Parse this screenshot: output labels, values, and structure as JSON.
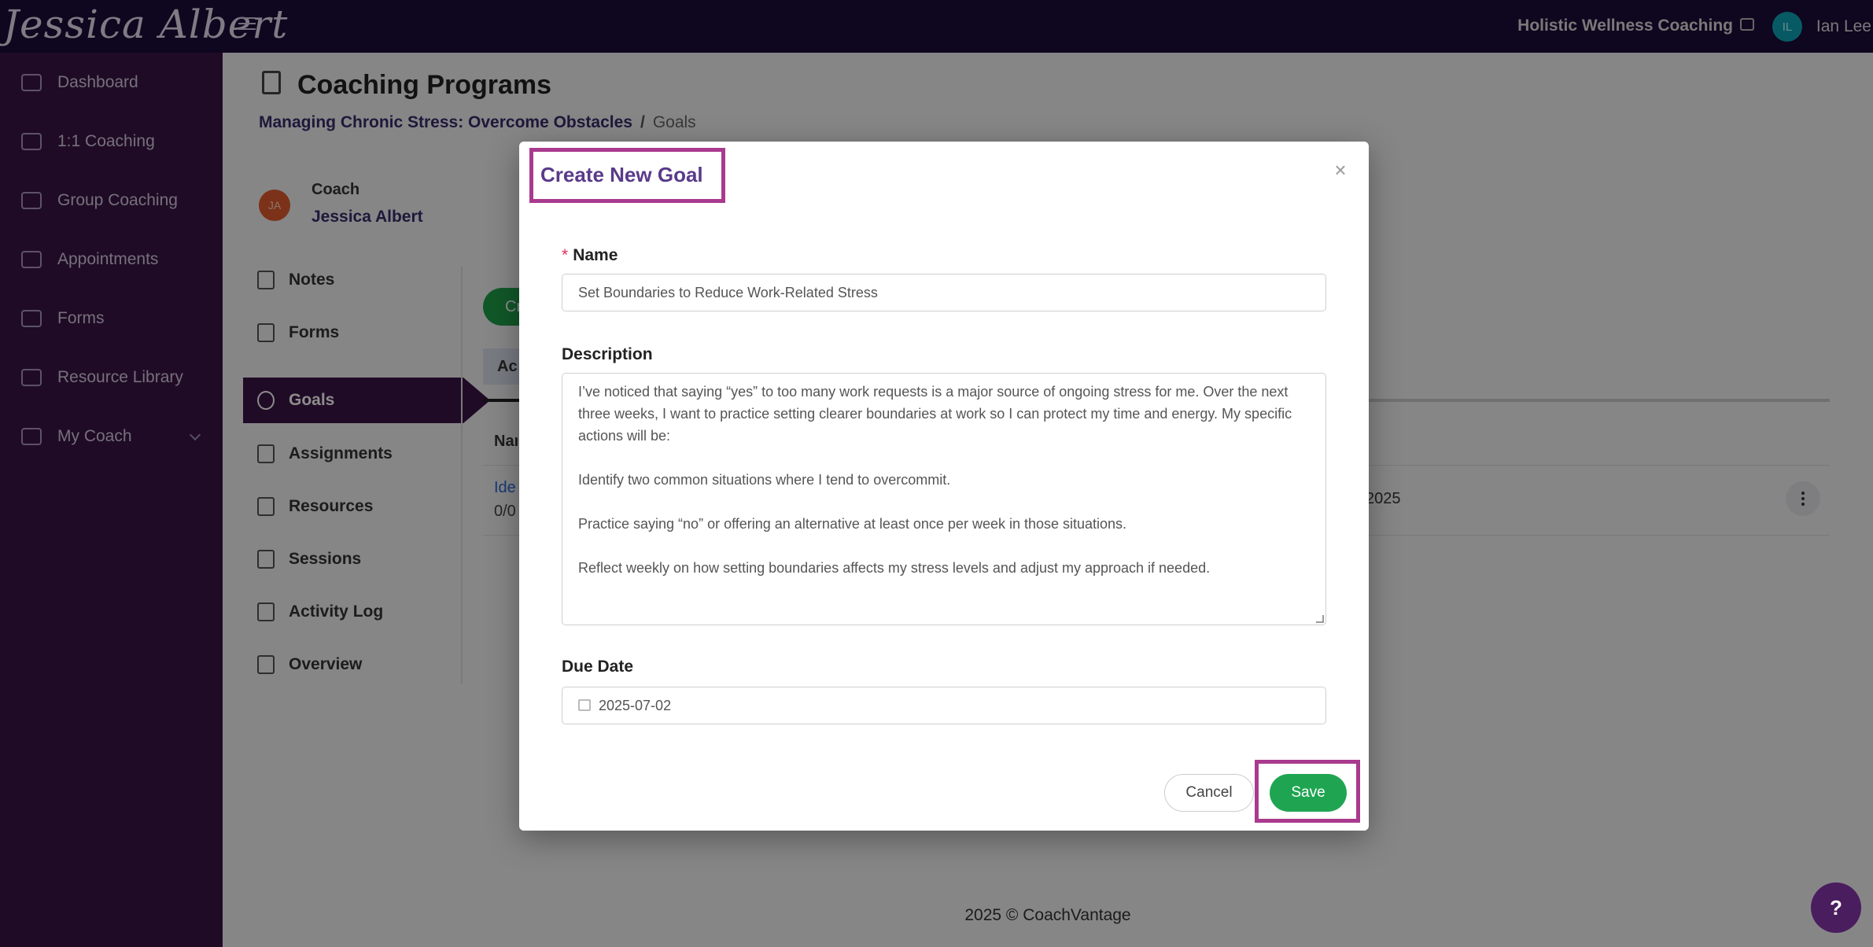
{
  "topbar": {
    "brand": "Jessica Albert",
    "org_name": "Holistic Wellness Coaching",
    "user_initials": "IL",
    "user_name": "Ian Lee"
  },
  "sidebar": {
    "items": [
      {
        "label": "Dashboard"
      },
      {
        "label": "1:1 Coaching"
      },
      {
        "label": "Group Coaching"
      },
      {
        "label": "Appointments"
      },
      {
        "label": "Forms"
      },
      {
        "label": "Resource Library"
      },
      {
        "label": "My Coach"
      }
    ]
  },
  "page": {
    "title": "Coaching Programs",
    "breadcrumb_parent": "Managing Chronic Stress: Overcome Obstacles",
    "breadcrumb_sep": "/",
    "breadcrumb_current": "Goals"
  },
  "coach": {
    "initials": "JA",
    "label": "Coach",
    "name": "Jessica Albert"
  },
  "subnav": {
    "items": [
      {
        "label": "Notes"
      },
      {
        "label": "Forms"
      },
      {
        "label": "Goals"
      },
      {
        "label": "Assignments"
      },
      {
        "label": "Resources"
      },
      {
        "label": "Sessions"
      },
      {
        "label": "Activity Log"
      },
      {
        "label": "Overview"
      }
    ]
  },
  "background": {
    "create_button_partial": "Cr",
    "tab_partial": "Ac",
    "table_header_partial": "Nar",
    "row_link_partial": "Ide",
    "row_progress_partial": "0/0",
    "row_date_partial": "2025"
  },
  "footer": {
    "text": "2025 © CoachVantage"
  },
  "modal": {
    "title": "Create New Goal",
    "close_glyph": "×",
    "name_label": "Name",
    "required_mark": "*",
    "name_value": "Set Boundaries to Reduce Work-Related Stress",
    "description_label": "Description",
    "description_paragraphs": [
      "I’ve noticed that saying “yes” to too many work requests is a major source of ongoing stress for me. Over the next three weeks, I want to practice setting clearer boundaries at work so I can protect my time and energy. My specific actions will be:",
      "Identify two common situations where I tend to overcommit.",
      "Practice saying “no” or offering an alternative at least once per week in those situations.",
      "Reflect weekly on how setting boundaries affects my stress levels and adjust my approach if needed."
    ],
    "due_date_label": "Due Date",
    "due_date_value": "2025-07-02",
    "cancel_label": "Cancel",
    "save_label": "Save"
  },
  "help": {
    "label": "?"
  }
}
